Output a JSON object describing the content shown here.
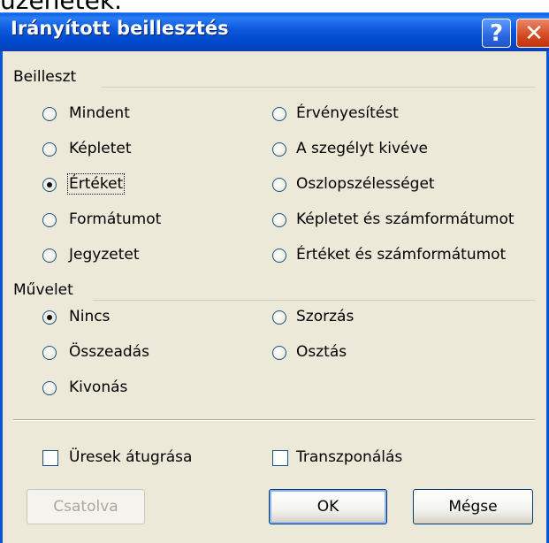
{
  "top_text": "üzenetek.",
  "title": "Irányított beillesztés",
  "title_buttons": {
    "help": "?",
    "close": "✕"
  },
  "beilleszt": {
    "label": "Beilleszt",
    "options": [
      {
        "label": "Mindent",
        "checked": false
      },
      {
        "label": "Képletet",
        "checked": false
      },
      {
        "label": "Értéket",
        "checked": true
      },
      {
        "label": "Formátumot",
        "checked": false
      },
      {
        "label": "Jegyzetet",
        "checked": false
      },
      {
        "label": "Érvényesítést",
        "checked": false
      },
      {
        "label": "A szegélyt kivéve",
        "checked": false
      },
      {
        "label": "Oszlopszélességet",
        "checked": false
      },
      {
        "label": "Képletet és számformátumot",
        "checked": false
      },
      {
        "label": "Értéket és számformátumot",
        "checked": false
      }
    ]
  },
  "muvelet": {
    "label": "Művelet",
    "options": [
      {
        "label": "Nincs",
        "checked": true
      },
      {
        "label": "Összeadás",
        "checked": false
      },
      {
        "label": "Kivonás",
        "checked": false
      },
      {
        "label": "Szorzás",
        "checked": false
      },
      {
        "label": "Osztás",
        "checked": false
      }
    ]
  },
  "checkboxes": [
    {
      "label": "Üresek átugrása",
      "checked": false
    },
    {
      "label": "Transzponálás",
      "checked": false
    }
  ],
  "buttons": {
    "link": "Csatolva",
    "ok": "OK",
    "cancel": "Mégse"
  },
  "colors": {
    "titlebar": "#0b56dc",
    "dialog_bg": "#ece9d8",
    "close": "#d5481f"
  }
}
